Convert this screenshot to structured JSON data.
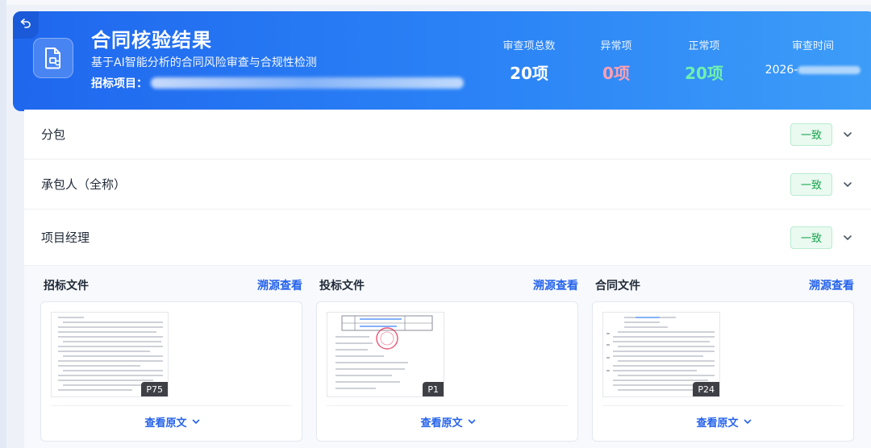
{
  "header": {
    "title": "合同核验结果",
    "subtitle": "基于AI智能分析的合同风险审查与合规性检测",
    "project_label": "招标项目：",
    "stats": {
      "total_label": "审查项总数",
      "total_value": "20项",
      "abnormal_label": "异常项",
      "abnormal_value": "0项",
      "normal_label": "正常项",
      "normal_value": "20项",
      "time_label": "审查时间",
      "time_prefix": "2026-"
    }
  },
  "rows": [
    {
      "label": "分包",
      "status": "一致"
    },
    {
      "label": "承包人（全称）",
      "status": "一致"
    },
    {
      "label": "项目经理",
      "status": "一致"
    }
  ],
  "sources": [
    {
      "title": "招标文件",
      "trace": "溯源查看",
      "page": "P75",
      "view": "查看原文"
    },
    {
      "title": "投标文件",
      "trace": "溯源查看",
      "page": "P1",
      "view": "查看原文"
    },
    {
      "title": "合同文件",
      "trace": "溯源查看",
      "page": "P24",
      "view": "查看原文"
    }
  ],
  "colors": {
    "header_start": "#1f67ee",
    "header_end": "#3d9df8",
    "abnormal": "#ff9fb2",
    "normal": "#6ff0b0",
    "badge_green": "#16a34a",
    "link_blue": "#2563eb"
  }
}
